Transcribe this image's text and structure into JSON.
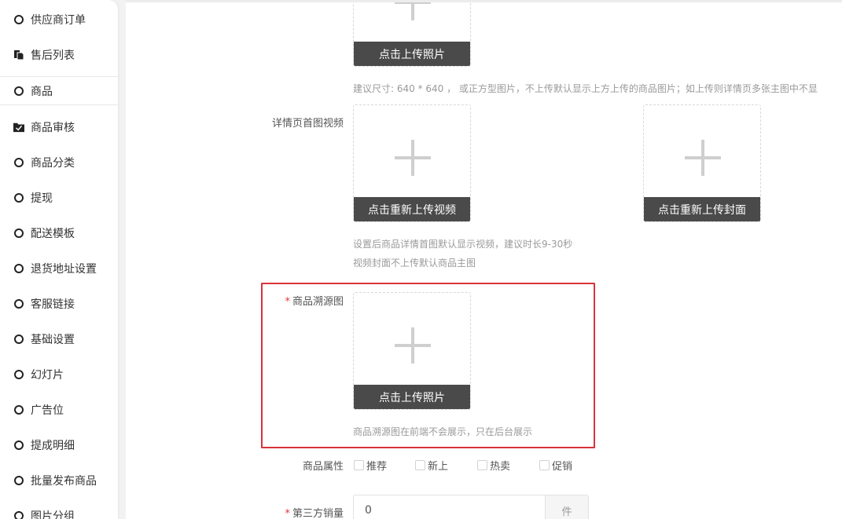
{
  "sidebar": {
    "items": [
      {
        "label": "供应商订单",
        "icon": "circle-icon"
      },
      {
        "label": "售后列表",
        "icon": "copy-icon"
      },
      {
        "label": "商品",
        "icon": "circle-icon",
        "active": true
      },
      {
        "label": "商品审核",
        "icon": "folder-check-icon"
      },
      {
        "label": "商品分类",
        "icon": "circle-icon"
      },
      {
        "label": "提现",
        "icon": "circle-icon"
      },
      {
        "label": "配送模板",
        "icon": "circle-icon"
      },
      {
        "label": "退货地址设置",
        "icon": "circle-icon"
      },
      {
        "label": "客服链接",
        "icon": "circle-icon"
      },
      {
        "label": "基础设置",
        "icon": "circle-icon"
      },
      {
        "label": "幻灯片",
        "icon": "circle-icon"
      },
      {
        "label": "广告位",
        "icon": "circle-icon"
      },
      {
        "label": "提成明细",
        "icon": "circle-icon"
      },
      {
        "label": "批量发布商品",
        "icon": "circle-icon"
      },
      {
        "label": "图片分组",
        "icon": "circle-icon"
      }
    ]
  },
  "form": {
    "main_image": {
      "upload_label": "点击上传照片",
      "hint": "建议尺寸: 640 * 640 ， 或正方型图片，不上传默认显示上方上传的商品图片；如上传则详情页多张主图中不显"
    },
    "detail_video": {
      "label": "详情页首图视频",
      "video_button": "点击重新上传视频",
      "cover_button": "点击重新上传封面",
      "hint_line1": "设置后商品详情首图默认显示视频，建议时长9-30秒",
      "hint_line2": "视频封面不上传默认商品主图"
    },
    "trace_image": {
      "required_mark": "*",
      "label": "商品溯源图",
      "upload_label": "点击上传照片",
      "hint": "商品溯源图在前端不会展示，只在后台展示"
    },
    "attributes": {
      "label": "商品属性",
      "options": [
        "推荐",
        "新上",
        "热卖",
        "促销"
      ]
    },
    "third_party_sales": {
      "required_mark": "*",
      "label": "第三方销量",
      "value": "0",
      "unit": "件"
    }
  },
  "colors": {
    "required": "#e4393c",
    "highlight_border": "#d9333a",
    "upload_button_bg": "#4a4a4a"
  }
}
